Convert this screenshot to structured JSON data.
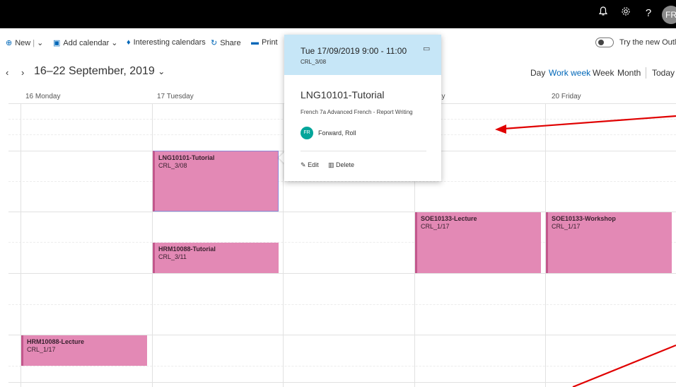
{
  "topbar": {
    "icons": [
      "bell-icon",
      "gear-icon",
      "help-icon"
    ],
    "avatar_initials": "FR"
  },
  "toolbar": {
    "new_label": "New",
    "add_calendar_label": "Add calendar",
    "interesting_label": "Interesting calendars",
    "share_label": "Share",
    "print_label": "Print",
    "try_new_label": "Try the new Outloo"
  },
  "nav": {
    "date_range": "16–22 September, 2019",
    "views": {
      "day": "Day",
      "work_week": "Work week",
      "week": "Week",
      "month": "Month",
      "today": "Today"
    }
  },
  "days": [
    "16 Monday",
    "17 Tuesday",
    "",
    "rsday",
    "20 Friday"
  ],
  "events": [
    {
      "title": "LNG10101-Tutorial",
      "location": "CRL_3/08"
    },
    {
      "title": "HRM10088-Tutorial",
      "location": "CRL_3/11"
    },
    {
      "title": "SOE10133-Lecture",
      "location": "CRL_1/17"
    },
    {
      "title": "SOE10133-Workshop",
      "location": "CRL_1/17"
    },
    {
      "title": "HRM10088-Lecture",
      "location": "CRL_1/17"
    }
  ],
  "popup": {
    "time": "Tue 17/09/2019 9:00 - 11:00",
    "location": "CRL_3/08",
    "title": "LNG10101-Tutorial",
    "description": "French 7a Advanced French - Report Writing",
    "organizer_initials": "FR",
    "organizer_name": "Forward, Roll",
    "edit_label": "Edit",
    "delete_label": "Delete"
  },
  "colors": {
    "event_fill": "#e389b5",
    "popup_header": "#c6e6f7",
    "accent": "#0067b8",
    "annotation_arrow": "#e00000"
  }
}
